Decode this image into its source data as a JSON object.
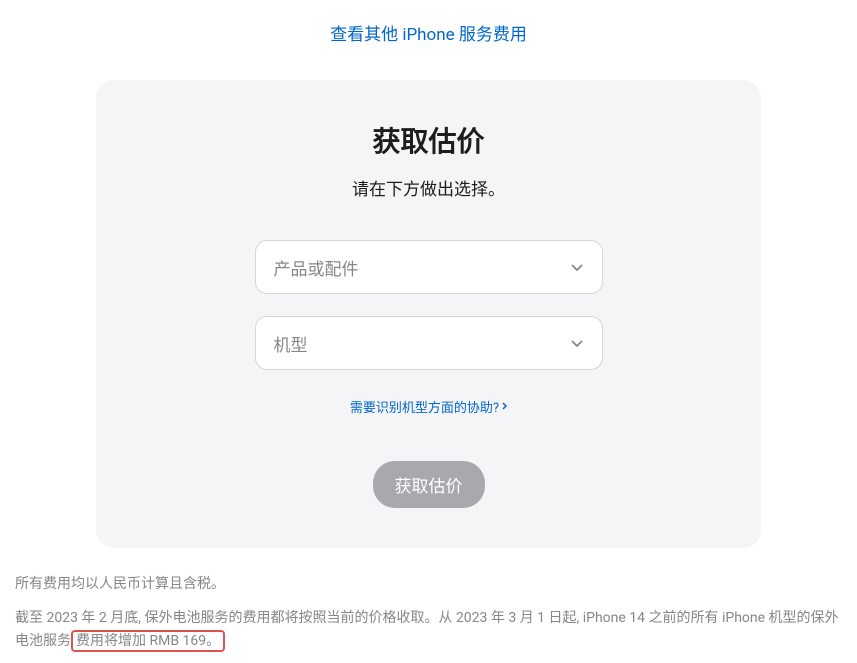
{
  "topLink": "查看其他 iPhone 服务费用",
  "card": {
    "title": "获取估价",
    "subtitle": "请在下方做出选择。",
    "select1Placeholder": "产品或配件",
    "select2Placeholder": "机型",
    "helpLink": "需要识别机型方面的协助?",
    "submitButton": "获取估价"
  },
  "footer": {
    "line1": "所有费用均以人民币计算且含税。",
    "line2Part1": "截至 2023 年 2 月底, 保外电池服务的费用都将按照当前的价格收取。从 2023 年 3 月 1 日起, iPhone 14 之前的所有 iPhone 机型的保外电池服务",
    "line2Highlight": "费用将增加 RMB 169。"
  }
}
